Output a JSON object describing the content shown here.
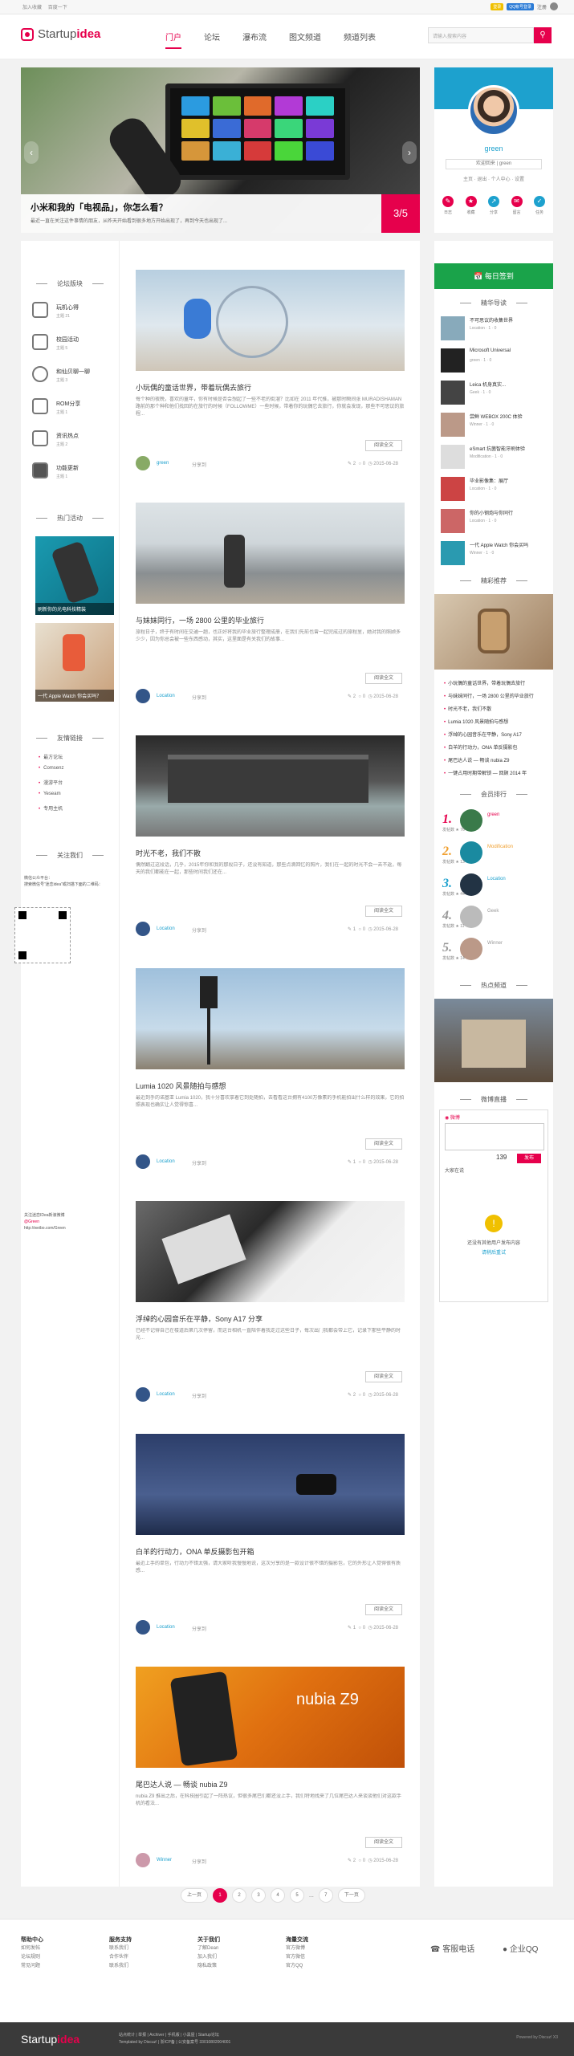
{
  "topbar": {
    "links": [
      "加入收藏",
      "百度一下"
    ],
    "badge1": "登录",
    "badge2": "QQ帐号登录",
    "reg": "注册"
  },
  "header": {
    "logo_a": "Startup",
    "logo_b": "idea",
    "nav": [
      "门户",
      "论坛",
      "瀑布流",
      "图文频道",
      "频道列表"
    ],
    "search_placeholder": "请输入搜索内容",
    "search_icon": "search-icon"
  },
  "slider": {
    "title": "小米和我的「电视品」，你怎么看？",
    "sub": "最近一直在关注这件事情的朋友，从昨天开始看到很多地方开始出现了，再到今天也出现了...",
    "num": "3/5"
  },
  "profile": {
    "name": "green",
    "box": "欢迎回来 | green",
    "links": "主页 · 退出 · 个人中心 · 设置",
    "icons": [
      {
        "label": "日志",
        "color": "#e6004c"
      },
      {
        "label": "收藏",
        "color": "#e6004c"
      },
      {
        "label": "分享",
        "color": "#1da1ce"
      },
      {
        "label": "留言",
        "color": "#e6004c"
      },
      {
        "label": "任务",
        "color": "#1da1ce"
      }
    ]
  },
  "left": {
    "forum_title": "论坛版块",
    "forums": [
      {
        "name": "玩机心得",
        "sub": "主题 21"
      },
      {
        "name": "校园活动",
        "sub": "主题 5"
      },
      {
        "name": "和仙贝聊一聊",
        "sub": "主题 3"
      },
      {
        "name": "ROM分享",
        "sub": "主题 1"
      },
      {
        "name": "资讯热点",
        "sub": "主题 2"
      },
      {
        "name": "功能更新",
        "sub": "主题 1"
      }
    ],
    "act_title": "热门活动",
    "acts": [
      "刷新你的光电科技精装",
      "一代 Apple Watch 你会买吗？"
    ],
    "friend_title": "友情链接",
    "friends": [
      "最方论坛",
      "Comsenz",
      "漫游平台",
      "Yeseam",
      "专用主机"
    ],
    "follow_title": "关注我们",
    "follow_text": "微信公众平台：",
    "follow_text2": "搜索微信号“迷恋idea”或扫描下面的二维码：",
    "follow_foot": "关注迷恋IDea新浪微博",
    "weibo": "@Green",
    "weibo_url": "http://weibo.com/Green"
  },
  "articles": [
    {
      "title": "小玩偶的童话世界，带着玩偶去旅行",
      "desc": "每个种的夜晚，喜欢的童年，你有时候是否会想起了一些不老的街溜？比如在 2011 年代推，被那时瞬间张 MURADISHAMAN 路前的那个种和他们找回的在旅行的时候（FOLLOWME）一些时候，带着你的玩偶它去旅行，你就会发现，那些不可思议的旅程...",
      "author": "green",
      "share": "分享到",
      "c1": "2",
      "c2": "0",
      "date": "2015-06-28",
      "read": "阅读全文"
    },
    {
      "title": "与妹妹同行，一场 2800 公里的毕业旅行",
      "desc": "旅程日子，终于有时间在交通一趟，也正好将我的毕业旅行整理成册，在我们先前也曾一起完成过的旅程里，她对我的照顾多少少，因为你总会被一些东西感动，其实，这里面是有关我们的故事...",
      "author": "Location",
      "share": "分享到",
      "c1": "2",
      "c2": "0",
      "date": "2015-06-28",
      "read": "阅读全文"
    },
    {
      "title": "时光不老，我们不散",
      "desc": "偶然翻过这段话，几乎，2015年你和我的那段日子，还没有知道，那些点滴回忆的照片，我们在一起的时光不会一去不返，每天的我们都能在一起，那些时间我们还在...",
      "author": "Location",
      "share": "分享到",
      "c1": "1",
      "c2": "0",
      "date": "2015-06-28",
      "read": "阅读全文"
    },
    {
      "title": "Lumia 1020 风景随拍与感想",
      "desc": "最近到手的诺基亚 Lumia 1020，我十分喜欢拿着它到处随拍，去看看这台拥有4100万像素的手机能拍出什么样的效果，它的拍照表现也确实让人觉得惊喜...",
      "author": "Location",
      "share": "分享到",
      "c1": "1",
      "c2": "0",
      "date": "2015-06-28",
      "read": "阅读全文"
    },
    {
      "title": "浮绰的心园音乐在平静，Sony A17 分享",
      "desc": "已经不记得自己在楼道后第几次停留，而这台相机一直陪伴着我走过这些日子，每次出门我都会带上它，记录下那些平静的时光...",
      "author": "Location",
      "share": "分享到",
      "c1": "2",
      "c2": "0",
      "date": "2015-06-28",
      "read": "阅读全文"
    },
    {
      "title": "白羊的行动力，ONA 单反摄影包开箱",
      "desc": "最近上手的单包，行动力不错太强，请大家听我慢慢地说，这次分享的是一款设计很不错的摄影包，它的外形让人觉得很有质感...",
      "author": "Location",
      "share": "分享到",
      "c1": "1",
      "c2": "0",
      "date": "2015-06-28",
      "read": "阅读全文"
    },
    {
      "title": "尾巴达人说 — 畅谈 nubia Z9",
      "desc": "nubia Z9 推出之后，在科技圈引起了一阵热议，但很多尾巴们都还没上手，我们特地找来了几位尾巴达人来谈谈他们对这款手机的看法...",
      "author": "Winner",
      "share": "分享到",
      "c1": "2",
      "c2": "0",
      "date": "2015-06-28",
      "read": "阅读全文"
    }
  ],
  "pager": {
    "prev": "上一页",
    "pages": [
      "1",
      "2",
      "3",
      "4",
      "5",
      "...",
      "7"
    ],
    "next": "下一页"
  },
  "right": {
    "sign": "每日签到",
    "hot_title": "精华导读",
    "hot": [
      {
        "title": "不可思议的收集世界",
        "meta": "Location · 1 · 0"
      },
      {
        "title": "Microsoft Universal",
        "meta": "green · 1 · 0"
      },
      {
        "title": "Leica 机身真实...",
        "meta": "Geek · 1 · 0"
      },
      {
        "title": "尝鲜 WEBOX 200C 体验",
        "meta": "Winner · 1 · 0"
      },
      {
        "title": "eSmart 抗菌智能牙刷体验",
        "meta": "Modification · 1 · 0"
      },
      {
        "title": "毕业影像集：展厅",
        "meta": "Location · 1 · 0"
      },
      {
        "title": "你的小钢炮与你同行",
        "meta": "Location · 1 · 0"
      },
      {
        "title": "一代 Apple Watch 你会买吗",
        "meta": "Winner · 1 · 0"
      }
    ],
    "rec_title": "精彩推荐",
    "rec": [
      "小玩偶的童话世界，带着玩偶去旅行",
      "与妹妹同行，一场 2800 公里的毕业旅行",
      "时光不老，我们不散",
      "Lumia 1020 风景随拍与感想",
      "浮绰的心园音乐在平静，Sony A17",
      "白羊的行动力，ONA 单反摄影包",
      "尾巴达人说 — 畅谈 nubia Z9",
      "一键占用时期带解锁 — 回顾 2014 年"
    ],
    "rank_title": "会员排行",
    "ranks": [
      {
        "n": "1.",
        "name": "green",
        "sub": "发帖数 ★ 76",
        "color": "#e6004c"
      },
      {
        "n": "2.",
        "name": "Modification",
        "sub": "发帖数 ★ 13",
        "color": "#f0a030"
      },
      {
        "n": "3.",
        "name": "Location",
        "sub": "发帖数 ★ 44",
        "color": "#1da1ce"
      },
      {
        "n": "4.",
        "name": "Geek",
        "sub": "发帖数 ★ 11",
        "color": "#999"
      },
      {
        "n": "5.",
        "name": "Winner",
        "sub": "发帖数 ★ 14",
        "color": "#999"
      }
    ],
    "topic_title": "热点频道",
    "weibo_title": "微博直播",
    "weibo_count": "139",
    "weibo_btn": "发布",
    "weibo_tab": "大家在说",
    "weibo_empty": "还没有其他用户发布内容",
    "weibo_refresh": "请稍后重试"
  },
  "footer": {
    "cols": [
      {
        "h": "帮助中心",
        "items": [
          "如何发帖",
          "论坛规则",
          "常见问题"
        ]
      },
      {
        "h": "服务支持",
        "items": [
          "联系我们",
          "合作伙伴",
          "联系我们"
        ]
      },
      {
        "h": "关于我们",
        "items": [
          "了解Dean",
          "加入我们",
          "隐私政策"
        ]
      },
      {
        "h": "海量交流",
        "items": [
          "官方微博",
          "官方微信",
          "官方QQ"
        ]
      }
    ],
    "phone": "客服电话",
    "qq": "企业QQ",
    "bar_logo_a": "Startup",
    "bar_logo_b": "idea",
    "bar_text1": "站点统计 | 举报 | Archiver | 手机版 | 小黑屋 | Startup论坛",
    "bar_text2": "Templated by Discuz! | 浙ICP备 | 公安备案号 33010802004001",
    "powered": "Powered by Discuz! X3"
  }
}
